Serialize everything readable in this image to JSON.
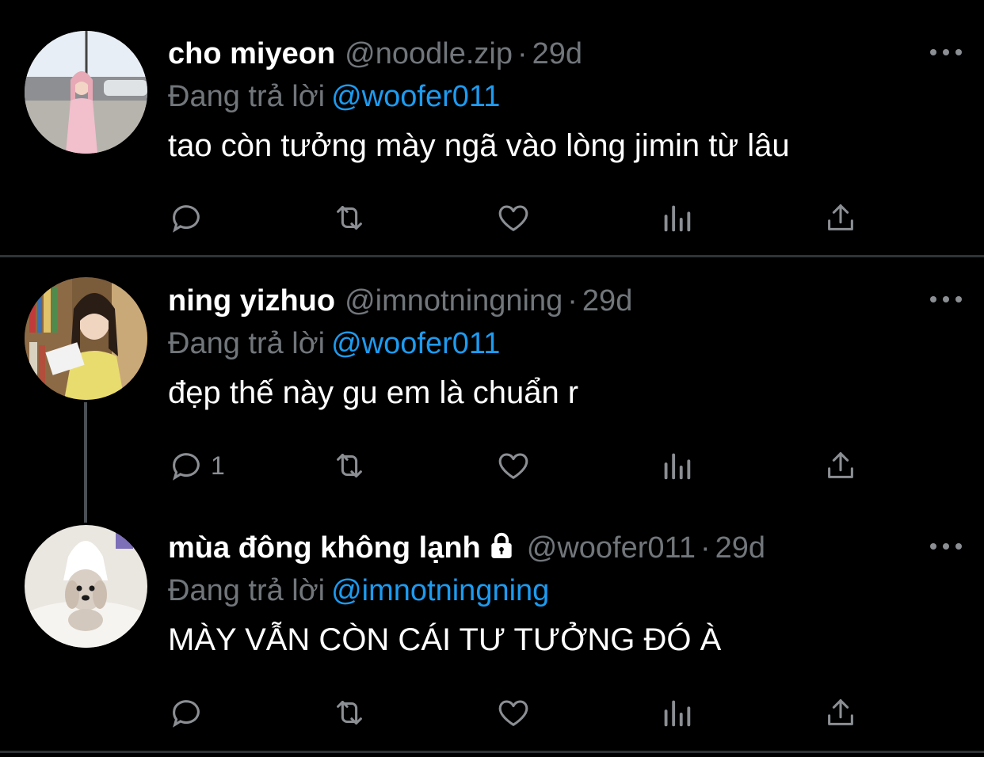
{
  "colors": {
    "background": "#000000",
    "name": "#ffffff",
    "muted": "#71767b",
    "mention": "#1d9bf0",
    "divider": "#2f3336"
  },
  "replying_label": "Đang trả lời",
  "tweets": [
    {
      "name": "cho miyeon",
      "handle": "@noodle.zip",
      "separator": "·",
      "time": "29d",
      "replying_to": "@woofer011",
      "text": "tao còn tưởng mày ngã vào lòng jimin từ lâu",
      "reply_count": "",
      "protected": false,
      "avatar_icon": "avatar-photo-street"
    },
    {
      "name": "ning yizhuo",
      "handle": "@imnotningning",
      "separator": "·",
      "time": "29d",
      "replying_to": "@woofer011",
      "text": "đẹp thế này gu em là chuẩn r",
      "reply_count": "1",
      "protected": false,
      "avatar_icon": "avatar-photo-bookshelf"
    },
    {
      "name": "mùa đông không lạnh",
      "handle": "@woofer011",
      "separator": "·",
      "time": "29d",
      "replying_to": "@imnotningning",
      "text": "MÀY VẪN CÒN CÁI TƯ TƯỞNG ĐÓ À",
      "reply_count": "",
      "protected": true,
      "avatar_icon": "avatar-photo-dog"
    }
  ],
  "action_icons": [
    "reply-icon",
    "retweet-icon",
    "like-icon",
    "views-icon",
    "share-icon"
  ]
}
